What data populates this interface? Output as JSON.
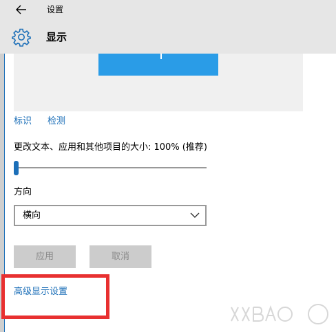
{
  "window": {
    "title": "设置"
  },
  "header": {
    "title": "显示",
    "icon": "gear-icon"
  },
  "preview": {
    "monitor_color": "#2a9ce7"
  },
  "links": {
    "identify": "标识",
    "detect": "检测",
    "advanced": "高级显示设置"
  },
  "scale": {
    "label": "更改文本、应用和其他项目的大小: 100% (推荐)",
    "value_fraction": 0.0
  },
  "orientation": {
    "label": "方向",
    "selected": "横向"
  },
  "buttons": {
    "apply": "应用",
    "cancel": "取消"
  },
  "colors": {
    "accent": "#1c6fb8",
    "highlight": "#e83030"
  }
}
